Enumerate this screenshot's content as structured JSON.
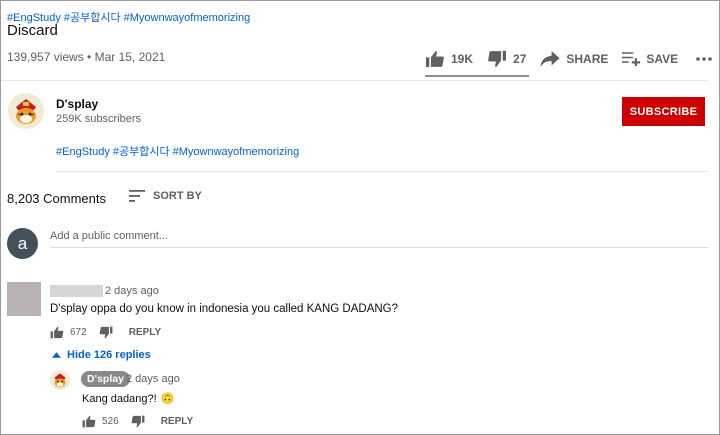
{
  "video": {
    "hashtags": "#EngStudy #공부합시다 #Myownwayofmemorizing",
    "title": "Discard",
    "views_date": "139,957 views • Mar 15, 2021"
  },
  "actions": {
    "likes": "19K",
    "dislikes": "27",
    "share_label": "SHARE",
    "save_label": "SAVE"
  },
  "channel": {
    "name": "D'splay",
    "subscribers": "259K subscribers",
    "subscribe_label": "SUBSCRIBE",
    "description_tags": "#EngStudy #공부합시다 #Myownwayofmemorizing"
  },
  "comments": {
    "count_label": "8,203 Comments",
    "sort_label": "SORT BY",
    "user_avatar_letter": "a",
    "add_placeholder": "Add a public comment...",
    "items": [
      {
        "time": "2 days ago",
        "text": "D'splay oppa do you know in indonesia you called KANG DADANG?",
        "likes": "672",
        "reply_label": "REPLY",
        "hide_replies_label": "Hide 126 replies",
        "replies": [
          {
            "author": "D'splay",
            "time": "2 days ago",
            "text": "Kang dadang?!",
            "emoji": "🙃",
            "likes": "526",
            "reply_label": "REPLY"
          }
        ]
      }
    ]
  },
  "colors": {
    "subscribe_red": "#cc0000",
    "link_blue": "#065fd4",
    "muted_text": "#606060"
  }
}
